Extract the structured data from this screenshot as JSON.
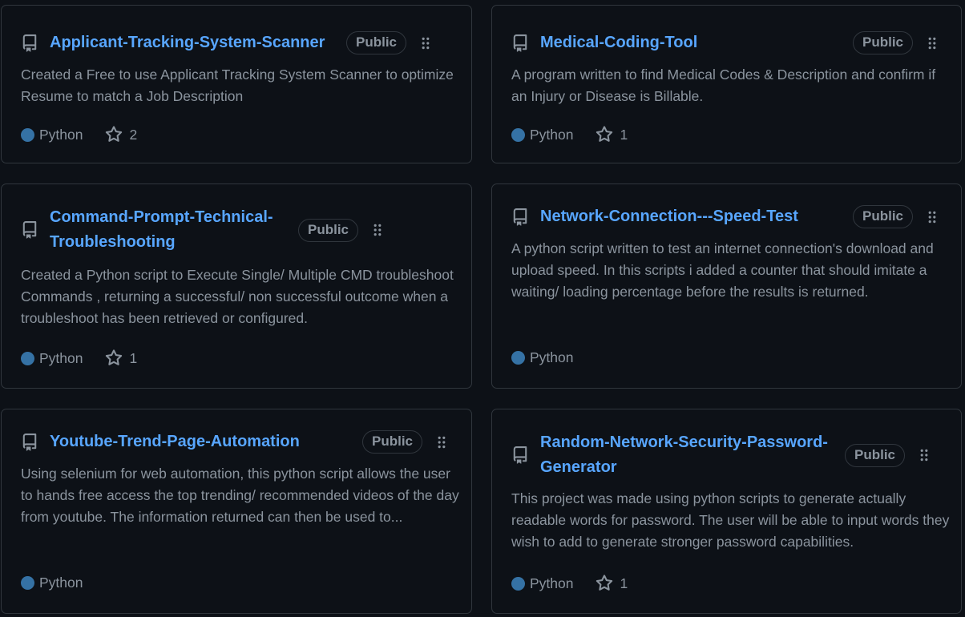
{
  "badge_label": "Public",
  "colors": {
    "background": "#0d1117",
    "border": "#30363d",
    "link": "#58a6ff",
    "muted": "#8b949e",
    "python": "#3572A5"
  },
  "icons": {
    "repo": "repo-icon",
    "grip": "grabber-icon",
    "star": "star-icon"
  },
  "repos": [
    {
      "name": "Applicant-Tracking-System-Scanner",
      "description": "Created a Free to use Applicant Tracking System Scanner to optimize Resume to match a Job Description",
      "language": "Python",
      "stars": "2"
    },
    {
      "name": "Medical-Coding-Tool",
      "description": "A program written to find Medical Codes & Description and confirm if an Injury or Disease is Billable.",
      "language": "Python",
      "stars": "1"
    },
    {
      "name": "Command-Prompt-Technical-Troubleshooting",
      "description": "Created a Python script to Execute Single/ Multiple CMD troubleshoot Commands , returning a successful/ non successful outcome when a troubleshoot has been retrieved or configured.",
      "language": "Python",
      "stars": "1"
    },
    {
      "name": "Network-Connection---Speed-Test",
      "description": "A python script written to test an internet connection's download and upload speed. In this scripts i added a counter that should imitate a waiting/ loading percentage before the results is returned.",
      "language": "Python",
      "stars": null
    },
    {
      "name": "Youtube-Trend-Page-Automation",
      "description": "Using selenium for web automation, this python script allows the user to hands free access the top trending/ recommended videos of the day from youtube. The information returned can then be used to...",
      "language": "Python",
      "stars": null
    },
    {
      "name": "Random-Network-Security-Password-Generator",
      "description": "This project was made using python scripts to generate actually readable words for password. The user will be able to input words they wish to add to generate stronger password capabilities.",
      "language": "Python",
      "stars": "1"
    }
  ]
}
